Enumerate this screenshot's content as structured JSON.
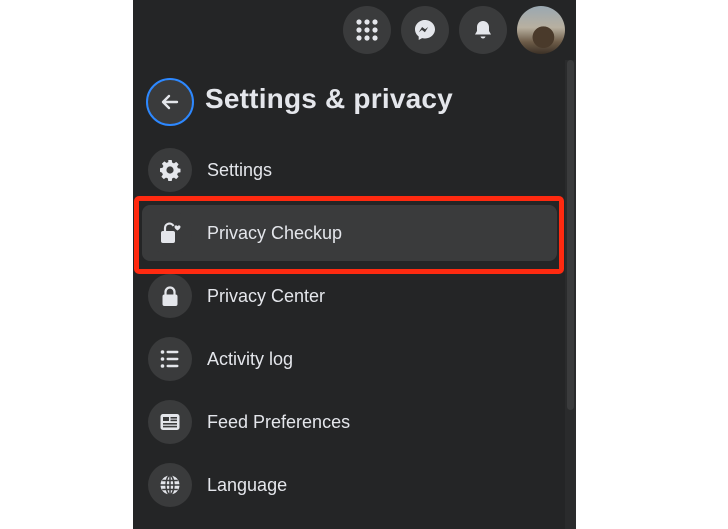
{
  "header": {
    "title": "Settings & privacy",
    "back_icon": "arrow-left-icon",
    "accent_color": "#2d88ff"
  },
  "topbar": {
    "buttons": [
      {
        "icon": "menu-grid-icon"
      },
      {
        "icon": "messenger-icon"
      },
      {
        "icon": "notifications-bell-icon"
      }
    ],
    "avatar_icon": "profile-avatar"
  },
  "menu": {
    "items": [
      {
        "label": "Settings",
        "icon": "gear-icon"
      },
      {
        "label": "Privacy Checkup",
        "icon": "lock-heart-icon"
      },
      {
        "label": "Privacy Center",
        "icon": "lock-icon"
      },
      {
        "label": "Activity log",
        "icon": "list-icon"
      },
      {
        "label": "Feed Preferences",
        "icon": "feed-icon"
      },
      {
        "label": "Language",
        "icon": "globe-icon"
      }
    ],
    "highlighted_item": "Privacy Checkup",
    "highlight_color": "#ff2a10"
  }
}
